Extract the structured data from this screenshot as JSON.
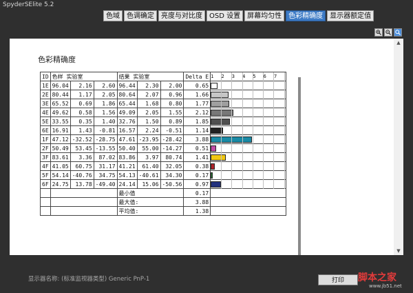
{
  "window": {
    "title": "SpyderSElite 5.2"
  },
  "tabs": [
    {
      "label": "色域",
      "active": false
    },
    {
      "label": "色调确定",
      "active": false
    },
    {
      "label": "亮度与对比度",
      "active": false
    },
    {
      "label": "OSD 设置",
      "active": false
    },
    {
      "label": "屏幕均匀性",
      "active": false
    },
    {
      "label": "色彩精确度",
      "active": true
    },
    {
      "label": "显示器额定值",
      "active": false
    }
  ],
  "report": {
    "title": "色彩精确度",
    "headers": {
      "id": "ID",
      "ref": "色样 实验室",
      "meas": "结果 实验室",
      "de": "Delta E"
    },
    "scale": [
      "1",
      "2",
      "3",
      "4",
      "5",
      "6",
      "7"
    ],
    "rows": [
      {
        "id": "1E",
        "r1": "96.04",
        "r2": "2.16",
        "r3": "2.60",
        "m1": "96.44",
        "m2": "2.30",
        "m3": "2.00",
        "de": "0.65",
        "de_val": 0.65,
        "color": "#ffffff"
      },
      {
        "id": "2E",
        "r1": "80.44",
        "r2": "1.17",
        "r3": "2.05",
        "m1": "80.64",
        "m2": "2.07",
        "m3": "0.96",
        "de": "1.66",
        "de_val": 1.66,
        "color": "#c6c6c6"
      },
      {
        "id": "3E",
        "r1": "65.52",
        "r2": "0.69",
        "r3": "1.86",
        "m1": "65.44",
        "m2": "1.68",
        "m3": "0.80",
        "de": "1.77",
        "de_val": 1.77,
        "color": "#9f9f9f"
      },
      {
        "id": "4E",
        "r1": "49.62",
        "r2": "0.58",
        "r3": "1.56",
        "m1": "49.09",
        "m2": "2.05",
        "m3": "1.55",
        "de": "2.12",
        "de_val": 2.12,
        "color": "#787878"
      },
      {
        "id": "5E",
        "r1": "33.55",
        "r2": "0.35",
        "r3": "1.40",
        "m1": "32.76",
        "m2": "1.50",
        "m3": "0.89",
        "de": "1.85",
        "de_val": 1.85,
        "color": "#505050"
      },
      {
        "id": "6E",
        "r1": "16.91",
        "r2": "1.43",
        "r3": "-0.81",
        "m1": "16.57",
        "m2": "2.24",
        "m3": "-0.51",
        "de": "1.14",
        "de_val": 1.14,
        "color": "#222222"
      },
      {
        "id": "1F",
        "r1": "47.12",
        "r2": "-32.52",
        "r3": "-28.75",
        "m1": "47.61",
        "m2": "-23.95",
        "m3": "-28.42",
        "de": "3.88",
        "de_val": 3.88,
        "color": "#1a8aa5"
      },
      {
        "id": "2F",
        "r1": "50.49",
        "r2": "53.45",
        "r3": "-13.55",
        "m1": "50.40",
        "m2": "55.00",
        "m3": "-14.27",
        "de": "0.51",
        "de_val": 0.51,
        "color": "#c24da8"
      },
      {
        "id": "3F",
        "r1": "83.61",
        "r2": "3.36",
        "r3": "87.02",
        "m1": "83.86",
        "m2": "3.97",
        "m3": "80.74",
        "de": "1.41",
        "de_val": 1.41,
        "color": "#f0c814"
      },
      {
        "id": "4F",
        "r1": "41.05",
        "r2": "60.75",
        "r3": "31.17",
        "m1": "41.21",
        "m2": "61.40",
        "m3": "32.05",
        "de": "0.38",
        "de_val": 0.38,
        "color": "#b0232a"
      },
      {
        "id": "5F",
        "r1": "54.14",
        "r2": "-40.76",
        "r3": "34.75",
        "m1": "54.13",
        "m2": "-40.61",
        "m3": "34.30",
        "de": "0.17",
        "de_val": 0.17,
        "color": "#2e8b3a"
      },
      {
        "id": "6F",
        "r1": "24.75",
        "r2": "13.78",
        "r3": "-49.40",
        "m1": "24.14",
        "m2": "15.06",
        "m3": "-50.56",
        "de": "0.97",
        "de_val": 0.97,
        "color": "#23327e"
      }
    ],
    "summary": [
      {
        "label": "最小值",
        "value": "0.17"
      },
      {
        "label": "最大值:",
        "value": "3.88"
      },
      {
        "label": "平均值:",
        "value": "1.38"
      }
    ]
  },
  "status": {
    "monitor_label": "显示器名称: (标准监视器类型) Generic PnP-1"
  },
  "buttons": {
    "print": "打印"
  },
  "watermark": {
    "text": "脚本之家",
    "url": "www.jb51.net"
  }
}
